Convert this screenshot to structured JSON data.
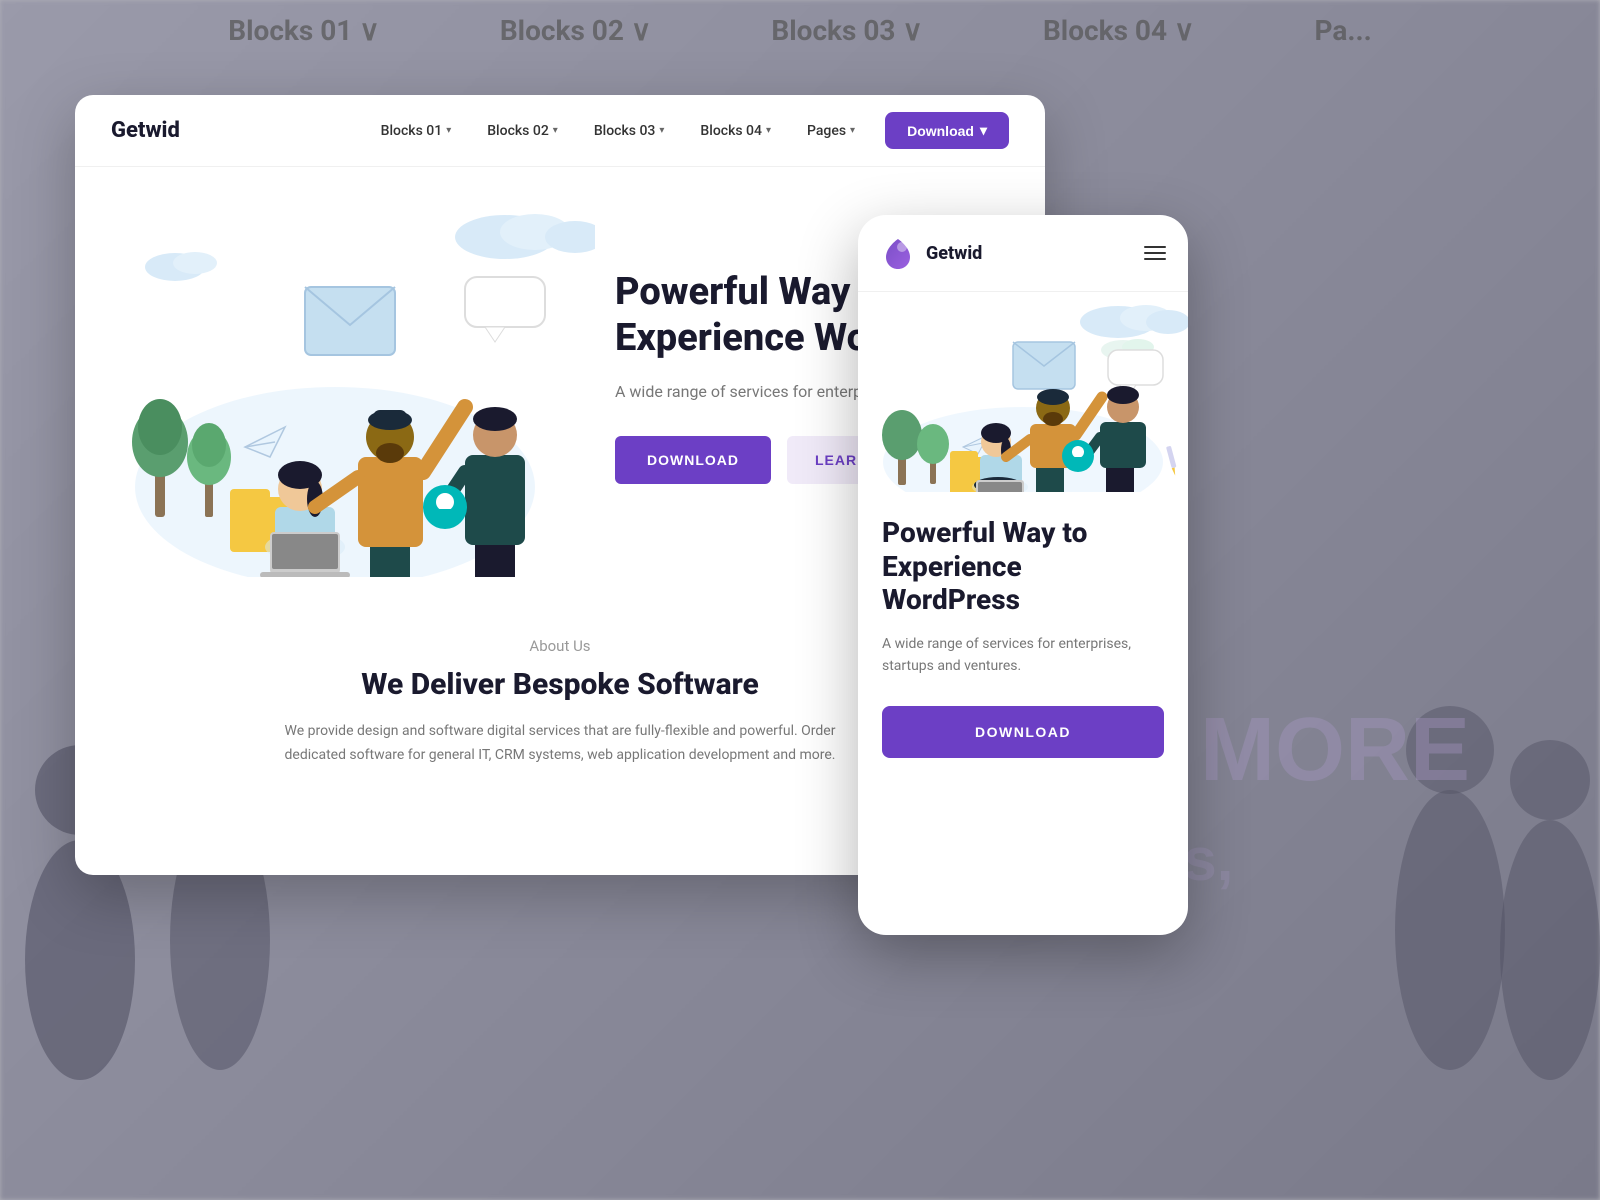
{
  "background": {
    "nav_items": [
      "Blocks 01",
      "Blocks 02",
      "Blocks 03",
      "Blocks 04",
      "Pa..."
    ]
  },
  "desktop_card": {
    "logo": "Getwid",
    "nav": {
      "items": [
        "Blocks 01",
        "Blocks 02",
        "Blocks 03",
        "Blocks 04",
        "Pages"
      ],
      "download_label": "Download"
    },
    "hero": {
      "title": "Powerful Way to Experience WordPress",
      "title_short": "Powerful Way t\nExperience Wor",
      "subtitle": "A wide range of services for enterprises, st...",
      "btn_download": "DOWNLOAD",
      "btn_learn_more": "LEARN MORE"
    },
    "about": {
      "label": "About Us",
      "title": "We Deliver Bespoke Software",
      "description": "We provide design and software digital services that are fully-flexible and powerful. Order dedicated software for general IT, CRM systems, web application development and more."
    }
  },
  "mobile_card": {
    "logo": "Getwid",
    "hero": {
      "title": "Powerful Way to Experience WordPress",
      "subtitle": "A wide range of services for enterprises, startups and ventures.",
      "btn_download": "DOWNLOAD"
    }
  },
  "colors": {
    "primary": "#6c3fc5",
    "primary_light": "#f0eaf8",
    "text_dark": "#1a1a2e",
    "text_muted": "#777777",
    "text_label": "#999999"
  }
}
